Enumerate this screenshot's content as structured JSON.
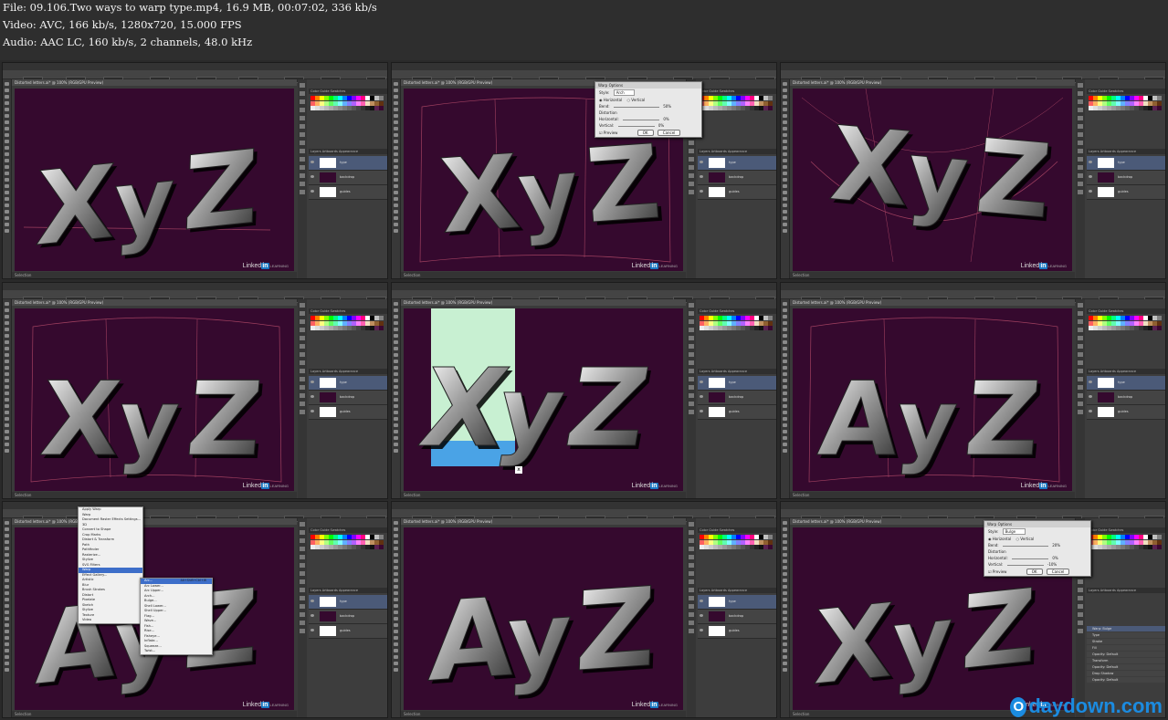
{
  "header": {
    "file_line": "File: 09.106.Two ways to warp type.mp4, 16.9 MB, 00:07:02, 336 kb/s",
    "video_line": "Video: AVC, 166 kb/s, 1280x720, 15.000 FPS",
    "audio_line": "Audio: AAC LC, 160 kb/s, 2 channels, 48.0 kHz"
  },
  "app": {
    "menu": [
      "File",
      "Edit",
      "Object",
      "Type",
      "Select",
      "Effect",
      "View",
      "Window",
      "Help"
    ],
    "control_bar": [
      "Stroke:",
      "Opacity:",
      "Style:",
      "Character:",
      "Myriad Pro",
      "Regular",
      "Paragraph",
      "Align",
      "Transform"
    ],
    "doc_tab": "Distorted letters.ai* @ 100% (RGB/GPU Preview)",
    "status": "Selection",
    "panel_tabs": [
      "Color Guide",
      "Swatches"
    ],
    "layer_tabs": [
      "Layers",
      "Artboards",
      "Appearance"
    ],
    "layers": [
      "type",
      "backdrop",
      "guides"
    ],
    "logo_text": "Linked",
    "logo_mark": "in",
    "logo_sub": "LEARNING"
  },
  "frames": [
    {
      "text": "XyZ",
      "warp": "tilt",
      "guides": "baseline",
      "dialog": false
    },
    {
      "text": "XyZ",
      "warp": "arch",
      "guides": "box",
      "dialog": true
    },
    {
      "text": "XyZ",
      "warp": "arch-up",
      "guides": "fan",
      "dialog": false
    },
    {
      "text": "XyZ",
      "warp": "arch-down",
      "guides": "box",
      "dialog": false
    },
    {
      "text": "XyZ",
      "warp": "flat",
      "guides": "none",
      "dialog": false,
      "select_box": true
    },
    {
      "text": "AyZ",
      "warp": "arch-down",
      "guides": "box",
      "dialog": false
    },
    {
      "text": "AyZ",
      "warp": "tilt",
      "guides": "none",
      "dialog": false,
      "menu": true
    },
    {
      "text": "AyZ",
      "warp": "bulge",
      "guides": "none",
      "dialog": false
    },
    {
      "text": "XyZ",
      "warp": "tilt",
      "guides": "none",
      "dialog": true,
      "appearance": true
    }
  ],
  "warp_dialog_1": {
    "title": "Warp Options",
    "style_label": "Style:",
    "style_value": "Arch",
    "horizontal": "Horizontal",
    "vertical": "Vertical",
    "bend_label": "Bend:",
    "bend_value": "50%",
    "distortion_label": "Distortion",
    "horizontal_label": "Horizontal:",
    "horizontal_value": "0%",
    "vertical_label": "Vertical:",
    "vertical_value": "0%",
    "preview": "Preview",
    "ok": "OK",
    "cancel": "Cancel"
  },
  "warp_dialog_2": {
    "title": "Warp Options",
    "style_label": "Style:",
    "style_value": "Bulge",
    "horizontal": "Horizontal",
    "vertical": "Vertical",
    "bend_label": "Bend:",
    "bend_value": "20%",
    "distortion_label": "Distortion",
    "horizontal_label": "Horizontal:",
    "horizontal_value": "0%",
    "vertical_label": "Vertical:",
    "vertical_value": "-10%",
    "preview": "Preview",
    "ok": "OK",
    "cancel": "Cancel"
  },
  "effect_menu": {
    "items": [
      "Apply Warp",
      "Warp",
      "Document Raster Effects Settings...",
      "3D",
      "Convert to Shape",
      "Crop Marks",
      "Distort & Transform",
      "Path",
      "Pathfinder",
      "Rasterize...",
      "Stylize",
      "SVG Filters",
      "Warp",
      "Effect Gallery...",
      "Artistic",
      "Blur",
      "Brush Strokes",
      "Distort",
      "Pixelate",
      "Sketch",
      "Stylize",
      "Texture",
      "Video"
    ],
    "submenu": [
      "Arc...",
      "Arc Lower...",
      "Arc Upper...",
      "Arch...",
      "Bulge...",
      "Shell Lower...",
      "Shell Upper...",
      "Flag...",
      "Wave...",
      "Fish...",
      "Rise...",
      "Fisheye...",
      "Inflate...",
      "Squeeze...",
      "Twist..."
    ],
    "shortcut": "Alt+Shift+Ctrl+W"
  },
  "appearance_items": [
    "Warp: Bulge",
    "Type",
    "Stroke",
    "Fill",
    "Opacity: Default",
    "Transform",
    "Opacity: Default",
    "Drop Shadow",
    "Opacity: Default"
  ],
  "watermark": {
    "text": "daydown.com",
    "mark": "O"
  },
  "colors": {
    "canvas": "#35092e",
    "accent": "#3d6ec9",
    "watermark": "#1b8be0"
  }
}
